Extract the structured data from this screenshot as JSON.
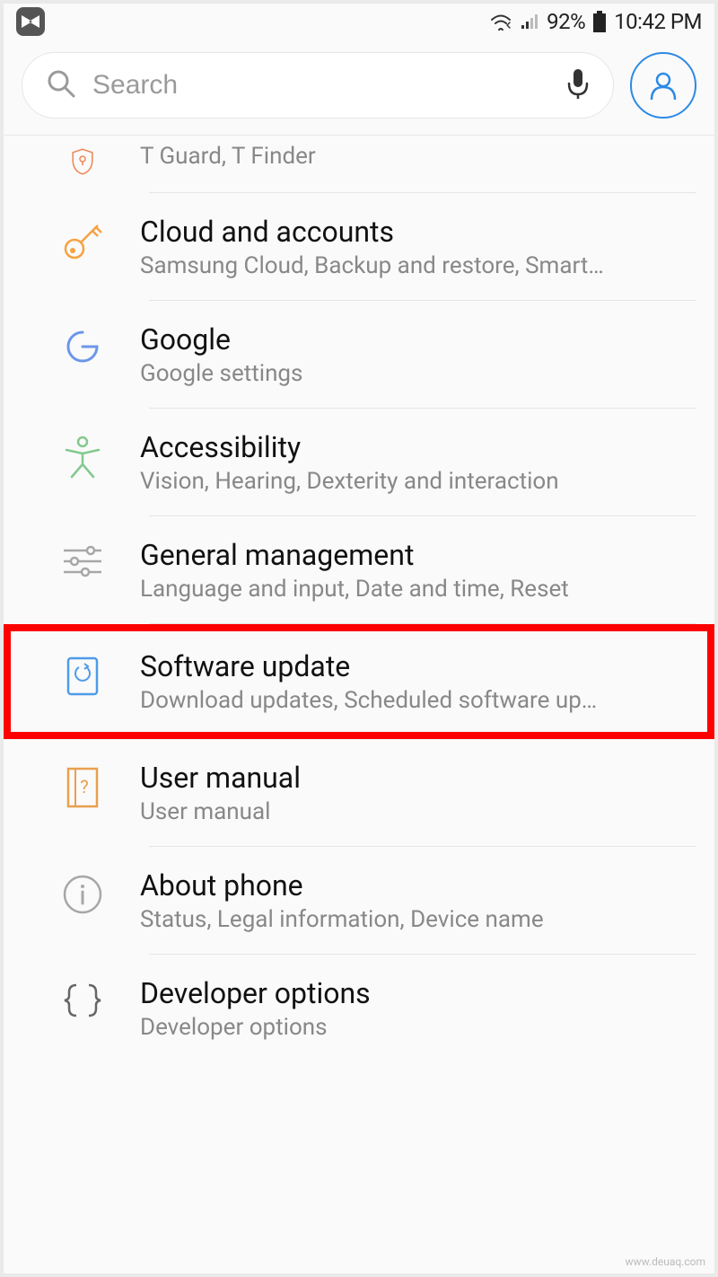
{
  "status": {
    "battery_pct": "92%",
    "time": "10:42 PM"
  },
  "search": {
    "placeholder": "Search"
  },
  "items": [
    {
      "title": "",
      "subtitle": "T Guard, T Finder"
    },
    {
      "title": "Cloud and accounts",
      "subtitle": "Samsung Cloud, Backup and restore, Smart…"
    },
    {
      "title": "Google",
      "subtitle": "Google settings"
    },
    {
      "title": "Accessibility",
      "subtitle": "Vision, Hearing, Dexterity and interaction"
    },
    {
      "title": "General management",
      "subtitle": "Language and input, Date and time, Reset"
    },
    {
      "title": "Software update",
      "subtitle": "Download updates, Scheduled software up…"
    },
    {
      "title": "User manual",
      "subtitle": "User manual"
    },
    {
      "title": "About phone",
      "subtitle": "Status, Legal information, Device name"
    },
    {
      "title": "Developer options",
      "subtitle": "Developer options"
    }
  ],
  "footer": {
    "watermark": "www.deuaq.com"
  }
}
